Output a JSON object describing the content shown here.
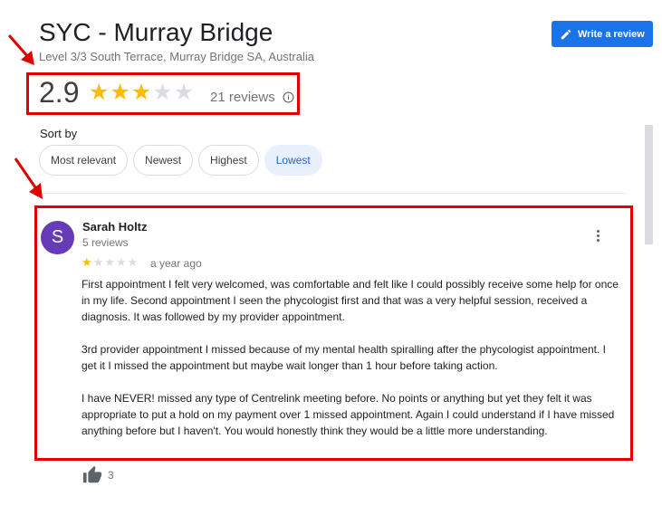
{
  "place": {
    "name": "SYC - Murray Bridge",
    "address": "Level 3/3 South Terrace, Murray Bridge SA, Australia"
  },
  "write_review": {
    "label": "Write a review",
    "icon": "pencil-icon"
  },
  "rating": {
    "value": "2.9",
    "stars_filled": 3,
    "stars_total": 5,
    "review_count": "21 reviews",
    "info_icon": "info-icon"
  },
  "sort": {
    "label": "Sort by",
    "options": [
      "Most relevant",
      "Newest",
      "Highest",
      "Lowest"
    ],
    "selected": "Lowest"
  },
  "review": {
    "avatar_letter": "S",
    "avatar_color": "#673ab7",
    "name": "Sarah Holtz",
    "meta": "5 reviews",
    "stars": 1,
    "time": "a year ago",
    "paragraphs": [
      "First appointment I felt very welcomed, was comfortable and felt like I could possibly receive some help for once in my life. Second appointment I seen the phycologist first and that was a very helpful session, received a diagnosis. It was followed by my provider appointment.",
      "3rd provider appointment I missed because of my mental health spiralling after the phycologist appointment. I get it I missed the appointment but maybe wait longer than 1 hour before taking action.",
      "I have NEVER! missed any type of Centrelink meeting before. No points or anything but yet they felt it was appropriate to put a hold on my payment over 1 missed appointment. Again I could understand if I have missed anything before but I haven't. You would honestly think they would be a little more understanding."
    ],
    "likes": "3"
  },
  "colors": {
    "accent": "#1a73e8",
    "star": "#fbbc04",
    "highlight": "#e00000"
  }
}
